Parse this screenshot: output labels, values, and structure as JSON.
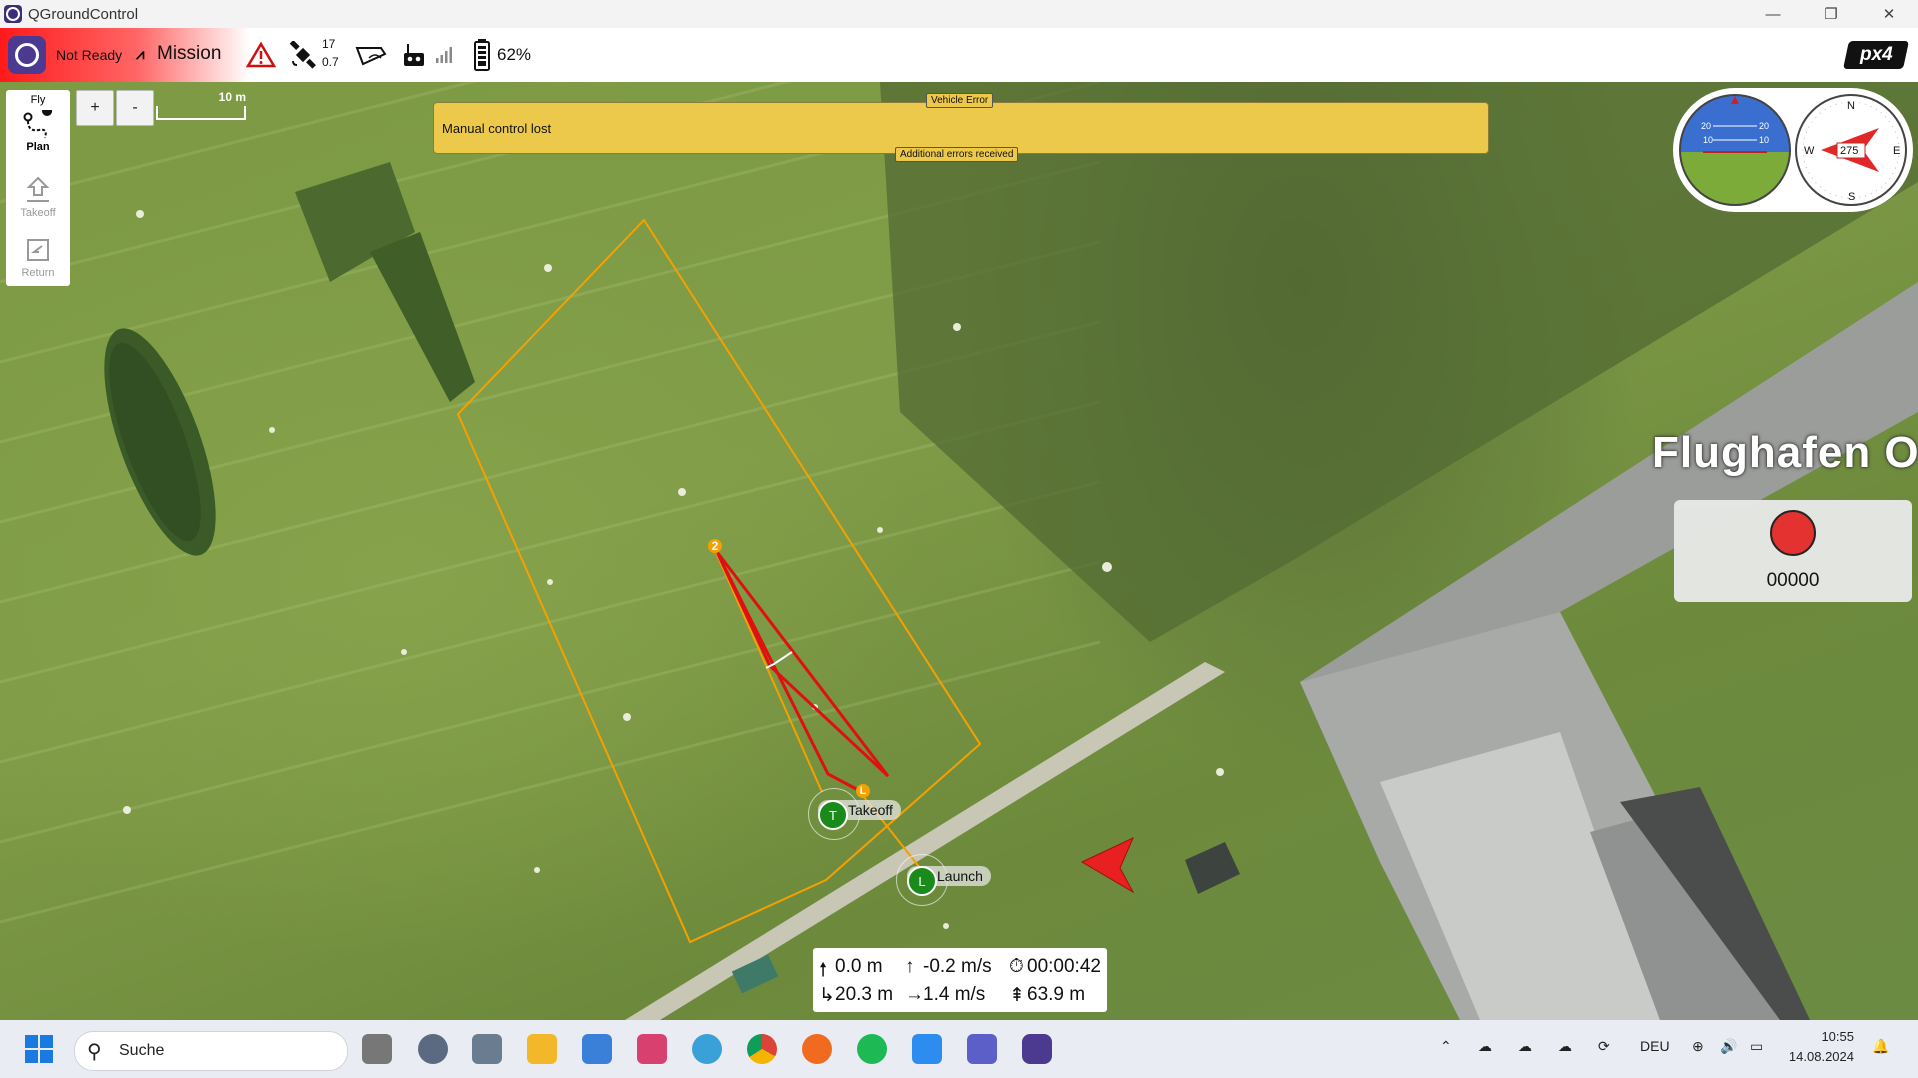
{
  "window": {
    "title": "QGroundControl",
    "buttons": [
      "—",
      "❐",
      "✕"
    ]
  },
  "toolbar": {
    "status": "Not Ready",
    "mode": "Mission",
    "satellites_count": "17",
    "satellites_hdop": "0.7",
    "battery": "62%",
    "brand": "px4"
  },
  "toolpanel": {
    "fly_label": "Fly",
    "plan_label": "Plan",
    "takeoff_label": "Takeoff",
    "return_label": "Return"
  },
  "zoom": {
    "in": "+",
    "out": "-",
    "scale": "10 m"
  },
  "banner": {
    "header": "Vehicle Error",
    "message": "Manual control lost",
    "footer": "Additional errors received"
  },
  "instruments": {
    "pitch_labels": [
      "20",
      "20",
      "10",
      "10"
    ],
    "compass": {
      "heading": "275",
      "n": "N",
      "s": "S",
      "e": "E",
      "w": "W"
    }
  },
  "map": {
    "place_label": "Flughafen Oc",
    "waypoint_2": "2",
    "takeoff_marker": "T",
    "takeoff_label": "Takeoff",
    "launch_marker": "L",
    "launch_label": "Launch",
    "land_marker": "L"
  },
  "record": {
    "counter": "00000"
  },
  "telemetry": {
    "altitude": "0.0 m",
    "vertical_speed": "-0.2 m/s",
    "flight_time": "00:00:42",
    "distance": "20.3 m",
    "horizontal_speed": "1.4 m/s",
    "distance_to_home": "63.9 m"
  },
  "taskbar": {
    "search_placeholder": "Suche",
    "language": "DEU",
    "time": "10:55",
    "date": "14.08.2024"
  },
  "colors": {
    "banner": "#ecc94a",
    "status_red": "#ff1a1a",
    "geofence": "#f5a000",
    "track": "#e01010",
    "record_red": "#e83030"
  }
}
